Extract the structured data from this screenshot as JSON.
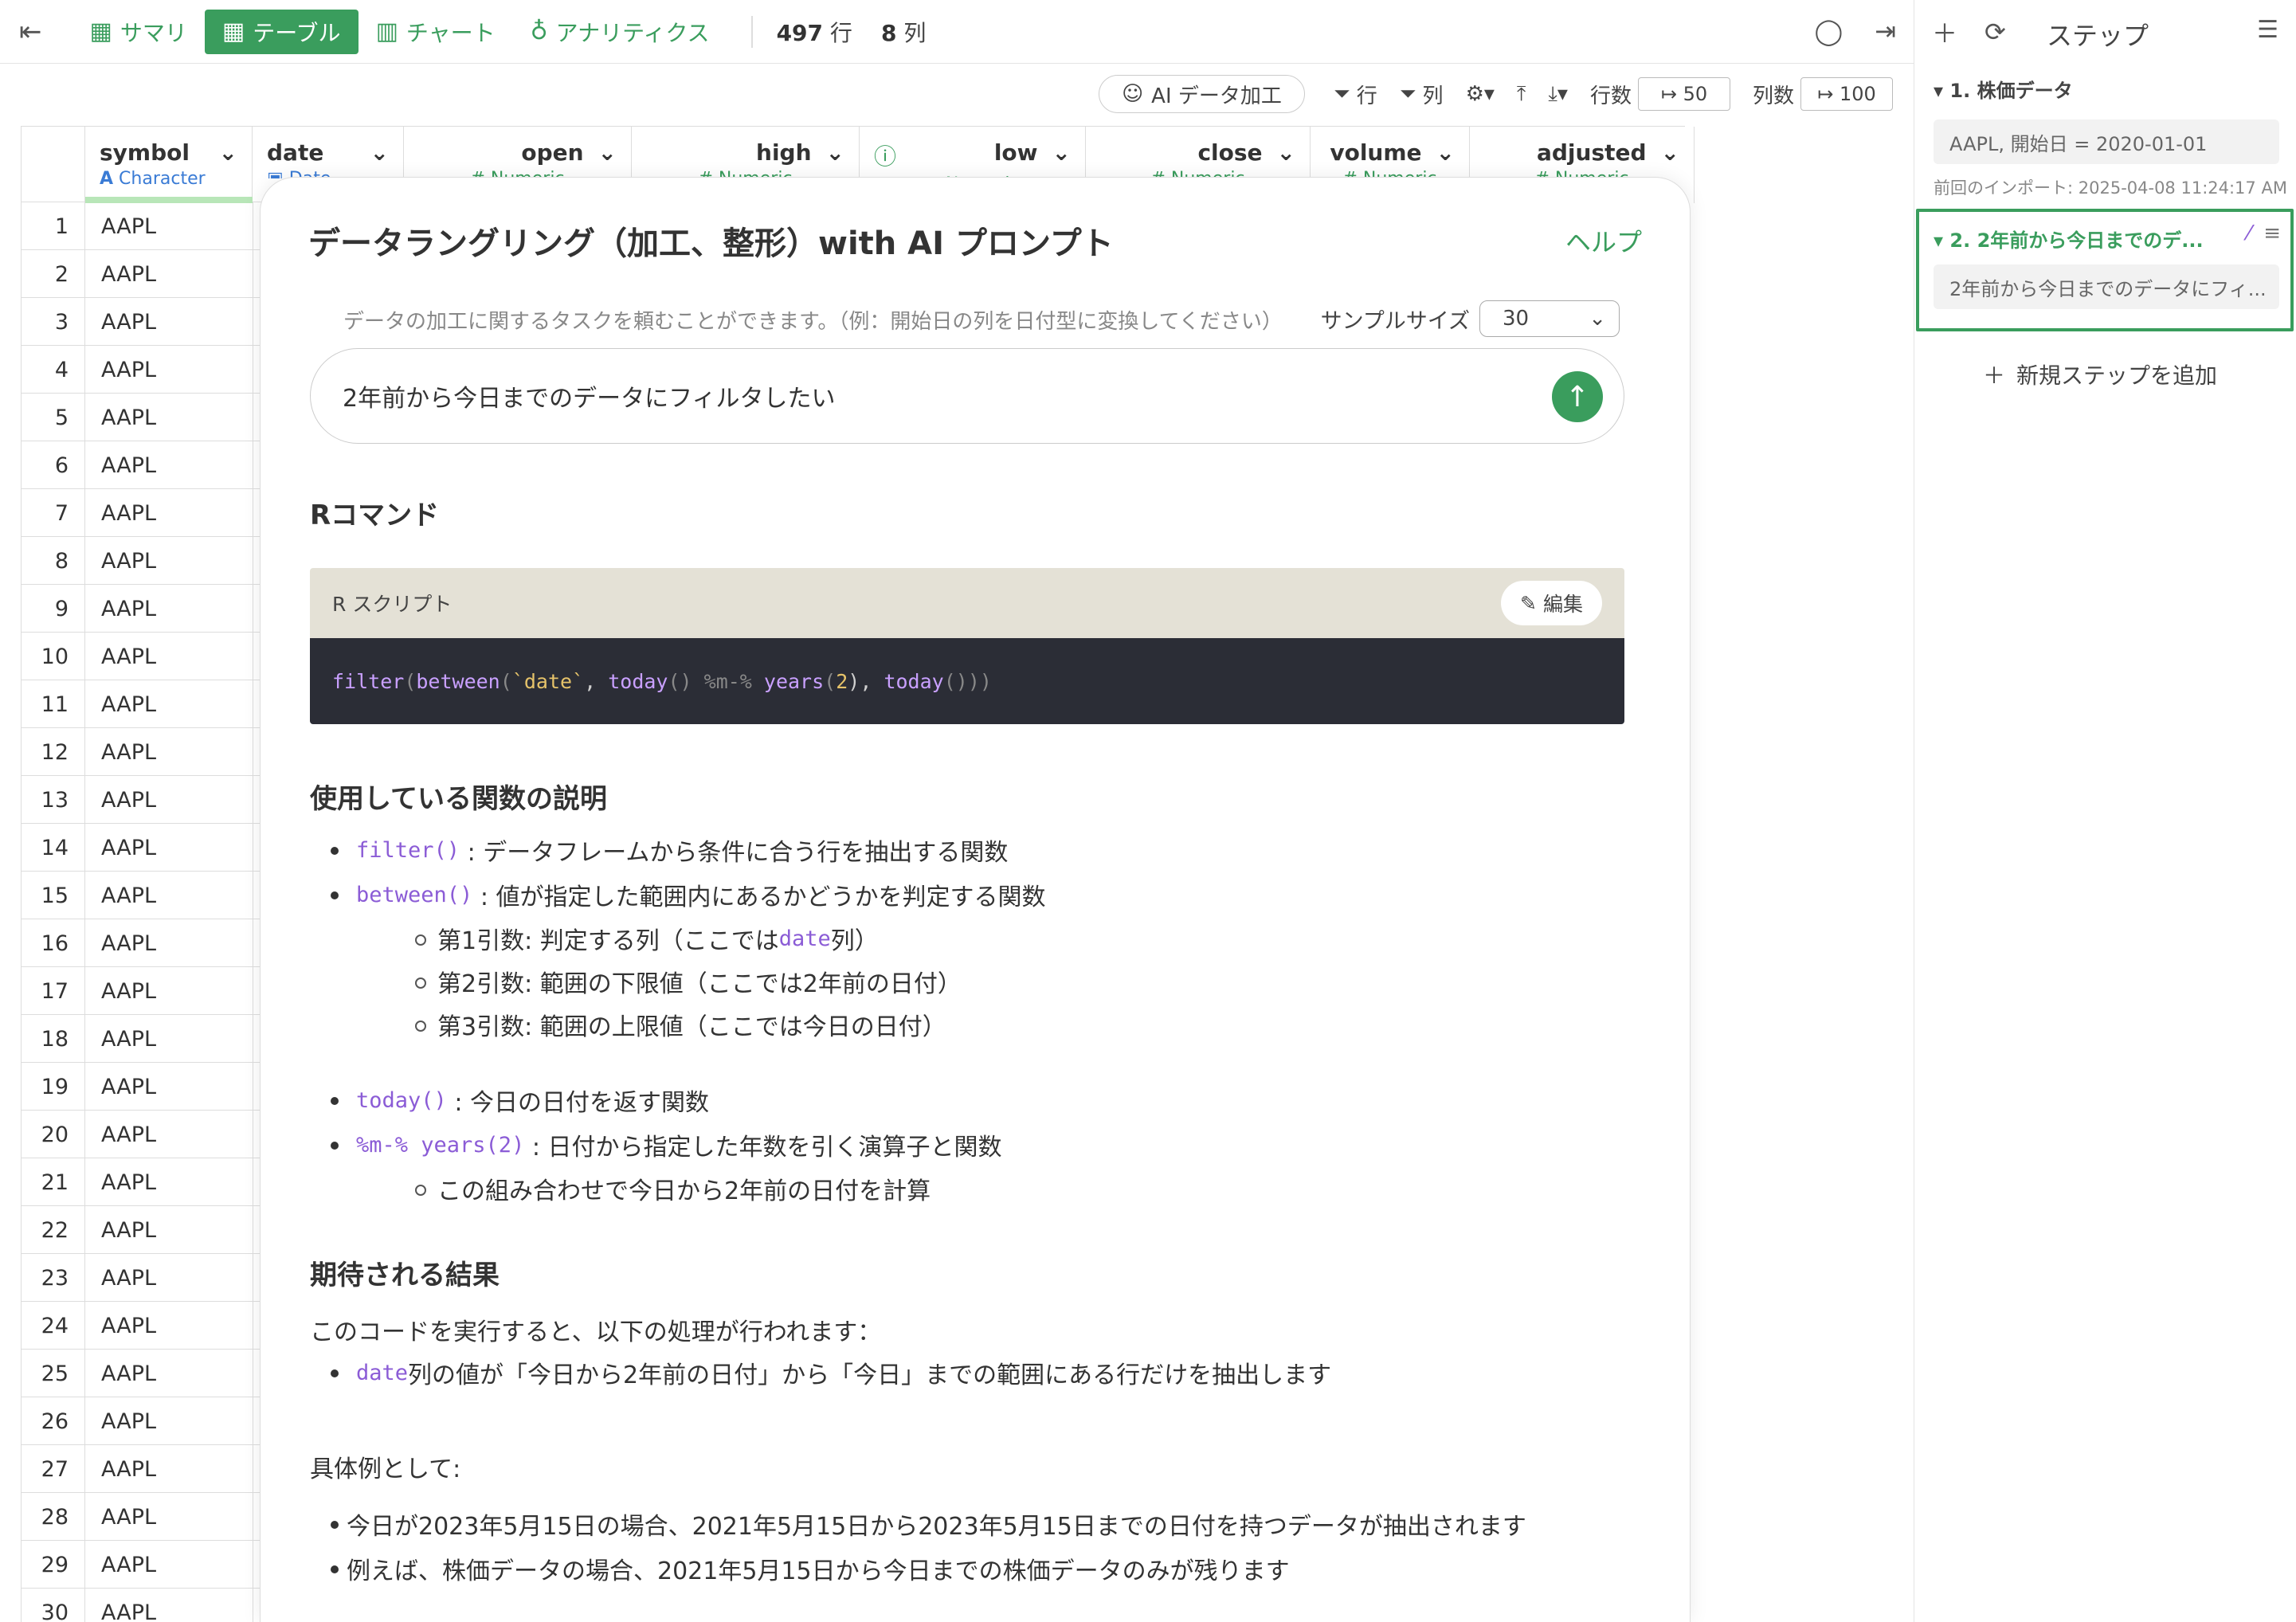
{
  "topbar": {
    "tabs": [
      {
        "label": "サマリ",
        "icon": "summary-table-icon"
      },
      {
        "label": "テーブル",
        "icon": "table-icon"
      },
      {
        "label": "チャート",
        "icon": "chart-icon"
      },
      {
        "label": "アナリティクス",
        "icon": "bulb-icon"
      }
    ],
    "row_count": "497",
    "row_unit": "行",
    "col_count": "8",
    "col_unit": "列"
  },
  "toolbar2": {
    "ai_button": "AI データ加工",
    "row_filter": "行",
    "col_filter": "列",
    "rows_label": "行数",
    "rows_value": "50",
    "cols_label": "列数",
    "cols_value": "100"
  },
  "table": {
    "columns": [
      {
        "name": "symbol",
        "type": "Character"
      },
      {
        "name": "date",
        "type": "Date"
      },
      {
        "name": "open",
        "type": "Numeric"
      },
      {
        "name": "high",
        "type": "Numeric"
      },
      {
        "name": "low",
        "type": "Numeric"
      },
      {
        "name": "close",
        "type": "Numeric"
      },
      {
        "name": "volume",
        "type": "Numeric"
      },
      {
        "name": "adjusted",
        "type": "Numeric"
      }
    ],
    "rows": [
      "1",
      "2",
      "3",
      "4",
      "5",
      "6",
      "7",
      "8",
      "9",
      "10",
      "11",
      "12",
      "13",
      "14",
      "15",
      "16",
      "17",
      "18",
      "19",
      "20",
      "21",
      "22",
      "23",
      "24",
      "25",
      "26",
      "27",
      "28",
      "29",
      "30"
    ],
    "symbol_value": "AAPL"
  },
  "modal": {
    "title": "データラングリング（加工、整形）with AI プロンプト",
    "help": "ヘルプ",
    "hint": "データの加工に関するタスクを頼むことができます。（例：開始日の列を日付型に変換してください）",
    "sample_label": "サンプルサイズ",
    "sample_value": "30",
    "prompt": "2年前から今日までのデータにフィルタしたい",
    "r_command_heading": "Rコマンド",
    "script_label": "R スクリプト",
    "edit_label": "編集",
    "code": {
      "f1": "filter",
      "p1": "(",
      "f2": "between",
      "p2": "(",
      "s1": "`date`",
      "c1": ", ",
      "f3": "today",
      "p3": "() %m-% ",
      "f4": "years",
      "p4": "(",
      "n1": "2",
      "p5": "), ",
      "f5": "today",
      "p6": "()))"
    },
    "functions_heading": "使用している関数の説明",
    "functions": {
      "filter_code": "filter()",
      "filter_desc": ": データフレームから条件に合う行を抽出する関数",
      "between_code": "between()",
      "between_desc": ": 値が指定した範囲内にあるかどうかを判定する関数",
      "arg1_pre": "第1引数: 判定する列（ここでは ",
      "arg1_code": "date",
      "arg1_post": " 列）",
      "arg2": "第2引数: 範囲の下限値（ここでは2年前の日付）",
      "arg3": "第3引数: 範囲の上限値（ここでは今日の日付）",
      "today_code": "today()",
      "today_desc": ": 今日の日付を返す関数",
      "years_code": "%m-% years(2)",
      "years_desc": ": 日付から指定した年数を引く演算子と関数",
      "combo": "この組み合わせで今日から2年前の日付を計算"
    },
    "result_heading": "期待される結果",
    "result_intro": "このコードを実行すると、以下の処理が行われます：",
    "result_code": "date",
    "result_desc": " 列の値が「今日から2年前の日付」から「今日」までの範囲にある行だけを抽出します",
    "example_heading": "具体例として:",
    "example1": "今日が2023年5月15日の場合、2021年5月15日から2023年5月15日までの日付を持つデータが抽出されます",
    "example2": "例えば、株価データの場合、2021年5月15日から今日までの株価データのみが残ります"
  },
  "steps": {
    "title": "ステップ",
    "step1_title": "1. 株価データ",
    "step1_detail": "AAPL, 開始日 = 2020-01-01",
    "step1_note": "前回のインポート: 2025-04-08 11:24:17 AM",
    "step2_title": "2. 2年前から今日までのデ...",
    "step2_detail": "2年前から今日までのデータにフィ...",
    "add_step": "新規ステップを追加"
  },
  "colors": {
    "accent": "#3a9d5d",
    "code_bg": "#2b2d36",
    "code_func": "#c9a0ff"
  }
}
